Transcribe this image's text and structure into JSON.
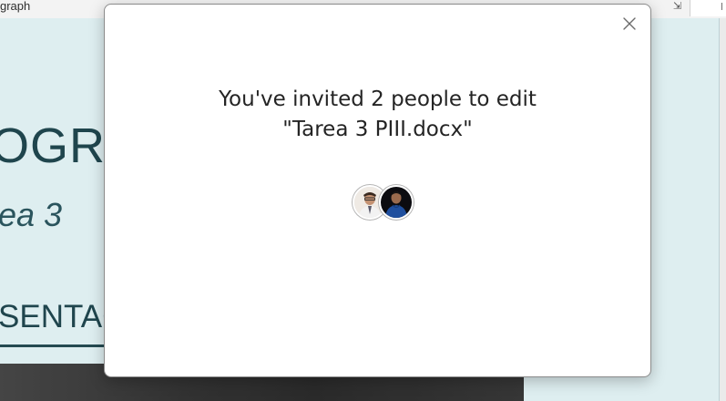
{
  "background_document": {
    "ribbon_label": "graph",
    "title_fragment": "OGRA",
    "subtitle_fragment": "ea 3",
    "heading_fragment": "SENTAC"
  },
  "dialog": {
    "close_icon": "close-icon",
    "title_line1": "You've invited 2 people to edit",
    "title_line2": "\"Tarea 3 PIII.docx\"",
    "avatars": [
      {
        "icon": "user-photo-avatar",
        "description_color": "#e8e0d8"
      },
      {
        "icon": "user-photo-avatar",
        "description_color": "#1f4f9e"
      }
    ]
  },
  "colors": {
    "dialog_background": "#ffffff",
    "title_text": "#242424",
    "document_page": "#dcedf0",
    "document_text": "#123a42"
  }
}
